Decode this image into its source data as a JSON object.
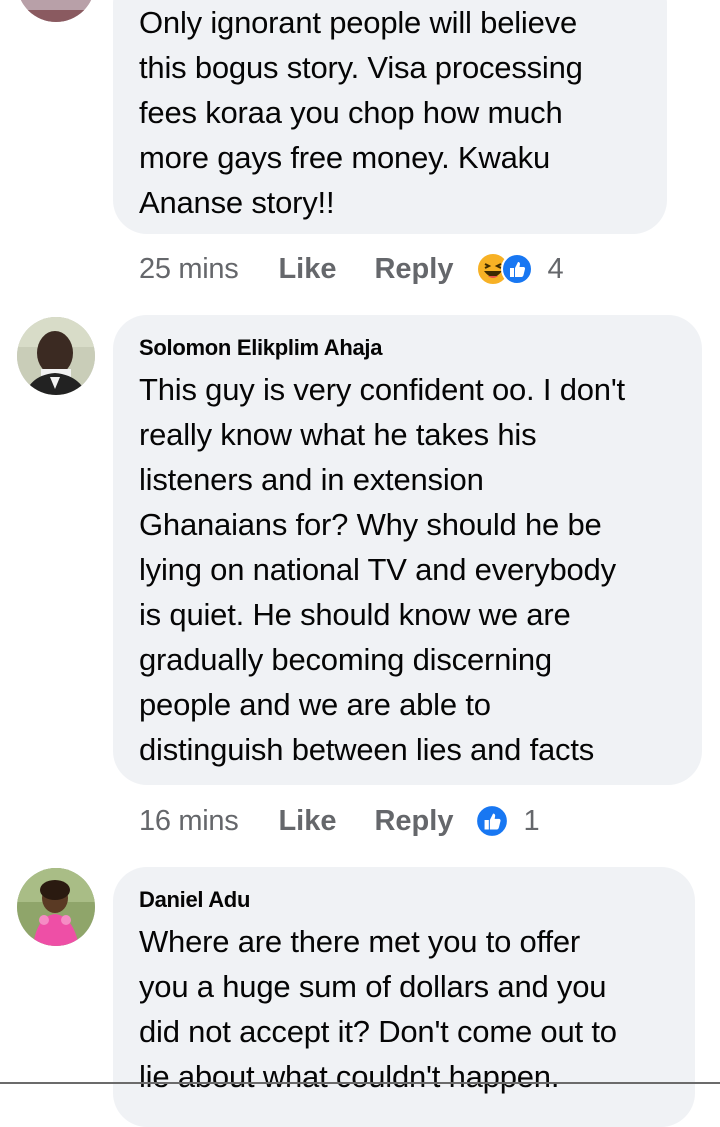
{
  "comments": [
    {
      "author": "",
      "text_lines": [
        "Only ignorant people will believe",
        "this bogus story. Visa processing",
        "fees koraa you chop how much",
        "more gays free money. Kwaku",
        "Ananse story!!"
      ],
      "time": "25 mins",
      "like_label": "Like",
      "reply_label": "Reply",
      "reactions": [
        "haha-icon",
        "like-icon"
      ],
      "reaction_count": "4"
    },
    {
      "author": "Solomon Elikplim Ahaja",
      "text_lines": [
        "This guy is very confident oo. I don't",
        "really know what he takes his",
        "listeners and in extension",
        "Ghanaians for? Why should he be",
        "lying on national TV and everybody",
        "is quiet. He should know we are",
        "gradually becoming discerning",
        "people and we are able to",
        "distinguish between lies and facts"
      ],
      "time": "16 mins",
      "like_label": "Like",
      "reply_label": "Reply",
      "reactions": [
        "like-icon"
      ],
      "reaction_count": "1"
    },
    {
      "author": "Daniel Adu",
      "text_lines": [
        "Where are there met you to offer",
        "you a huge sum of dollars and you",
        "did not accept it? Don't come out to",
        "lie about what couldn't happen."
      ]
    }
  ],
  "colors": {
    "bubble": "#f0f2f5",
    "meta_text": "#65676b",
    "like_blue": "#1877f2",
    "haha_yellow": "#f7b125"
  }
}
